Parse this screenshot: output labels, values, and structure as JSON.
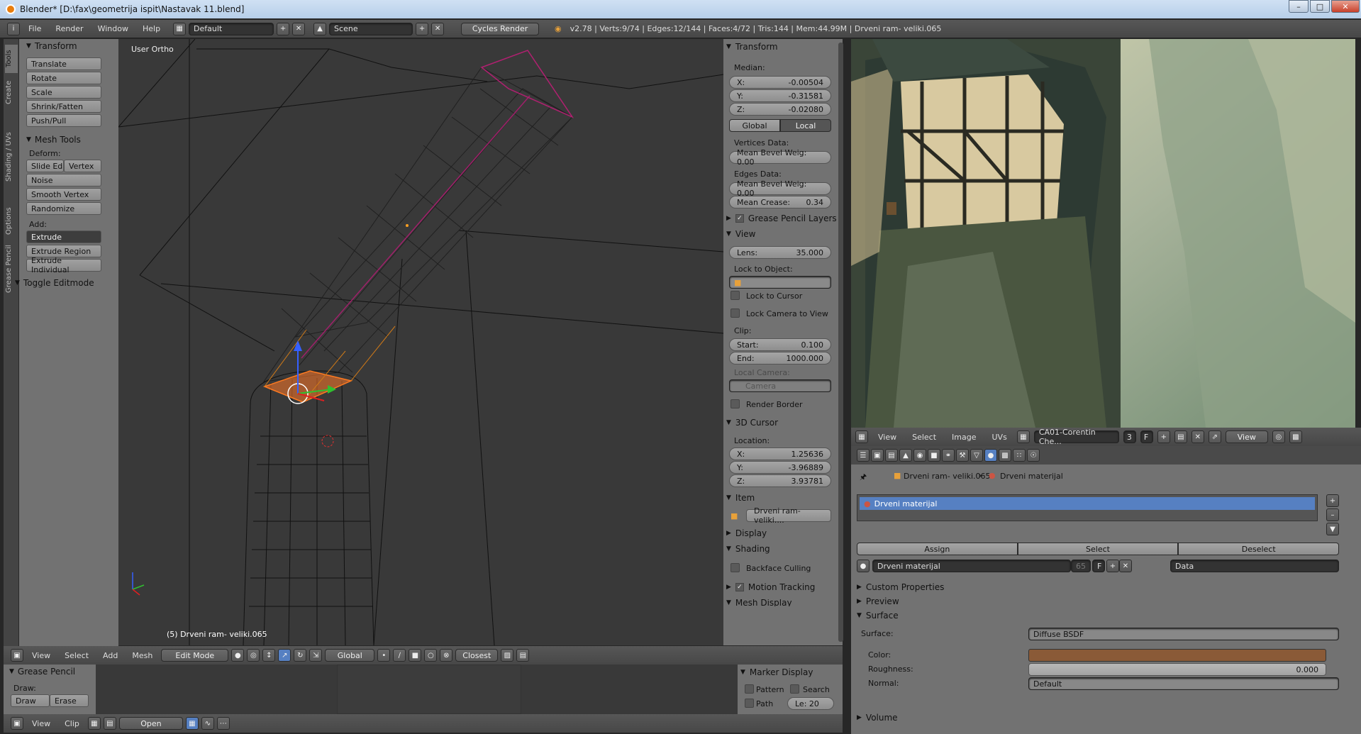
{
  "window": {
    "title": "Blender* [D:\\fax\\geometrija ispit\\Nastavak 11.blend]"
  },
  "topbar": {
    "menus": [
      "File",
      "Render",
      "Window",
      "Help"
    ],
    "layout": "Default",
    "scene": "Scene",
    "engine": "Cycles Render",
    "stats": "v2.78 | Verts:9/74 | Edges:12/144 | Faces:4/72 | Tris:144 | Mem:44.99M | Drveni ram- veliki.065"
  },
  "toolshelf": {
    "tabs": [
      "Tools",
      "Create",
      "Shading / UVs",
      "Options",
      "Grease Pencil"
    ],
    "transform_title": "Transform",
    "transform_tools": [
      "Translate",
      "Rotate",
      "Scale",
      "Shrink/Fatten",
      "Push/Pull"
    ],
    "mesh_tools_title": "Mesh Tools",
    "deform_label": "Deform:",
    "slide_edge": "Slide Ed",
    "vertex": "Vertex",
    "deform_tools": [
      "Noise",
      "Smooth Vertex",
      "Randomize"
    ],
    "add_label": "Add:",
    "extrude": "Extrude",
    "add_tools": [
      "Extrude Region",
      "Extrude Individual"
    ],
    "toggle_editmode": "Toggle Editmode"
  },
  "viewport": {
    "label": "User Ortho",
    "object_label": "(5) Drveni ram- veliki.065"
  },
  "npanel": {
    "transform": "Transform",
    "median": "Median:",
    "x_label": "X:",
    "x": "-0.00504",
    "y_label": "Y:",
    "y": "-0.31581",
    "z_label": "Z:",
    "z": "-0.02080",
    "global": "Global",
    "local": "Local",
    "vertices_data": "Vertices Data:",
    "mean_bevel_v": "Mean Bevel Weig: 0.00",
    "edges_data": "Edges Data:",
    "mean_bevel_e": "Mean Bevel Weig: 0.00",
    "mean_crease_label": "Mean Crease:",
    "mean_crease": "0.34",
    "grease_pencil_layers": "Grease Pencil Layers",
    "view": "View",
    "lens_label": "Lens:",
    "lens": "35.000",
    "lock_to_object": "Lock to Object:",
    "lock_to_cursor": "Lock to Cursor",
    "lock_camera": "Lock Camera to View",
    "clip": "Clip:",
    "start_label": "Start:",
    "start": "0.100",
    "end_label": "End:",
    "end": "1000.000",
    "local_camera": "Local Camera:",
    "camera": "Camera",
    "render_border": "Render Border",
    "cursor_3d": "3D Cursor",
    "location": "Location:",
    "cx": "1.25636",
    "cy": "-3.96889",
    "cz": "3.93781",
    "item": "Item",
    "item_name": "Drveni ram- veliki....",
    "display": "Display",
    "shading": "Shading",
    "backface": "Backface Culling",
    "motion_tracking": "Motion Tracking",
    "mesh_display": "Mesh Display",
    "marker_display": "Marker Display",
    "pattern": "Pattern",
    "search": "Search",
    "path": "Path",
    "le": "Le: 20"
  },
  "imgeditor": {
    "menus": [
      "View",
      "Select",
      "Image",
      "UVs"
    ],
    "image_name": "CA01-Corentin Che...",
    "users": "3",
    "fake": "F",
    "view": "View"
  },
  "properties": {
    "object": "Drveni ram- veliki.065",
    "material": "Drveni materijal",
    "slot": "Drveni materijal",
    "assign": "Assign",
    "select": "Select",
    "deselect": "Deselect",
    "mat_field": "Drveni materijal",
    "mat_users": "65",
    "mat_f": "F",
    "link": "Data",
    "custom_properties": "Custom Properties",
    "preview": "Preview",
    "surface_section": "Surface",
    "surface_label": "Surface:",
    "surface_value": "Diffuse BSDF",
    "color_label": "Color:",
    "color_hex": "#8a5a37",
    "roughness_label": "Roughness:",
    "roughness": "0.000",
    "normal_label": "Normal:",
    "normal": "Default",
    "volume": "Volume"
  },
  "vpheader": {
    "menus": [
      "View",
      "Select",
      "Add",
      "Mesh"
    ],
    "mode": "Edit Mode",
    "orientation": "Global",
    "snap": "Closest"
  },
  "bottom": {
    "grease_pencil": "Grease Pencil",
    "draw_label": "Draw:",
    "draw": "Draw",
    "erase": "Erase",
    "menus": [
      "View",
      "Clip"
    ],
    "open": "Open"
  }
}
